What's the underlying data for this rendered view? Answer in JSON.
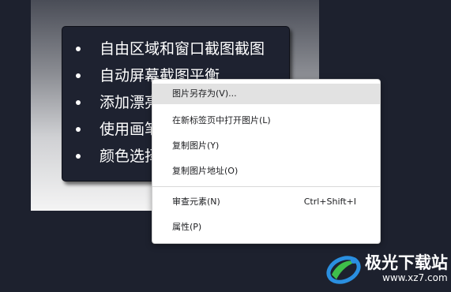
{
  "card": {
    "items": [
      {
        "text": "自由区域和窗口截图截图"
      },
      {
        "text": "自动屏幕截图平衡"
      },
      {
        "text": "添加漂亮"
      },
      {
        "text": "使用画笔"
      },
      {
        "text": "颜色选择"
      }
    ]
  },
  "context_menu": {
    "items": [
      {
        "label": "图片另存为(V)...",
        "shortcut": ""
      },
      {
        "label": "在新标签页中打开图片(L)",
        "shortcut": ""
      },
      {
        "label": "复制图片(Y)",
        "shortcut": ""
      },
      {
        "label": "复制图片地址(O)",
        "shortcut": ""
      },
      {
        "label": "审查元素(N)",
        "shortcut": "Ctrl+Shift+I"
      },
      {
        "label": "属性(P)",
        "shortcut": ""
      }
    ],
    "highlighted_index": 0
  },
  "watermark": {
    "brand": "极光下载站",
    "url": "www.xz7.com",
    "icon": "aurora-logo-icon"
  },
  "colors": {
    "background": "#1d212e",
    "card": "#1e2230",
    "menu_highlight": "#e2e2e2",
    "logo_blue": "#2a8fe0",
    "logo_green": "#3fbf4a"
  }
}
